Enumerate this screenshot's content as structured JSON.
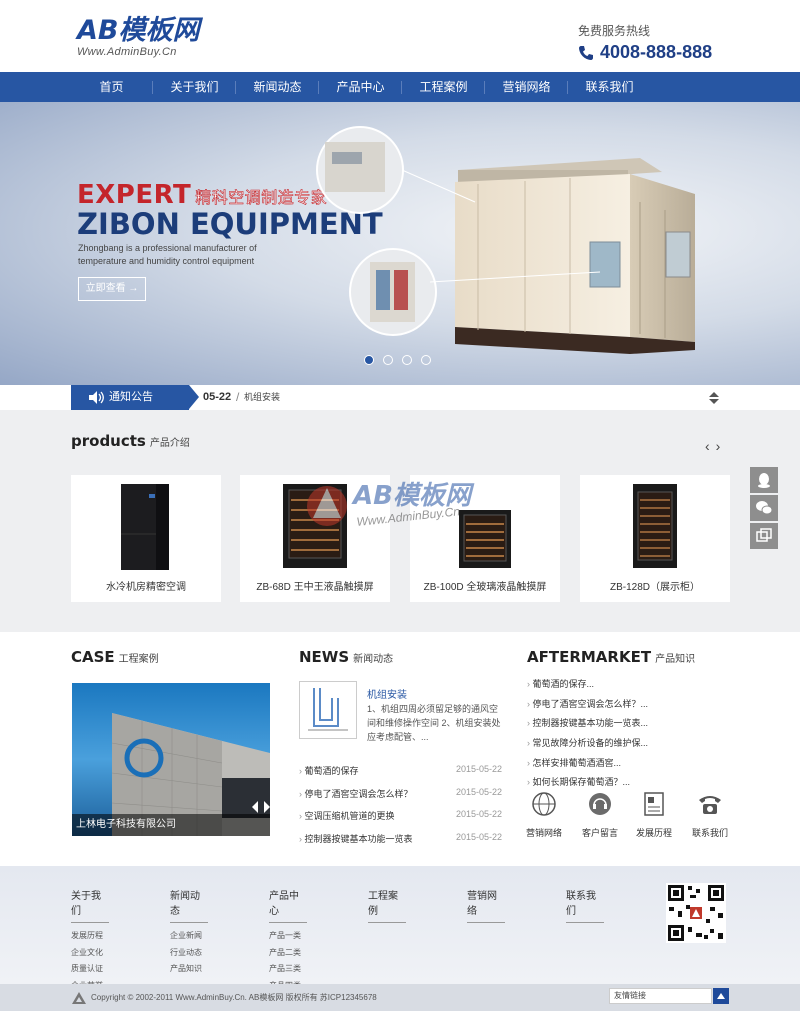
{
  "header": {
    "logo_main": "AB模板网",
    "logo_sub": "Www.AdminBuy.Cn",
    "hotline_label": "免费服务热线",
    "hotline_number": "4008-888-888"
  },
  "nav": {
    "items": [
      "首页",
      "关于我们",
      "新闻动态",
      "产品中心",
      "工程案例",
      "营销网络",
      "联系我们"
    ]
  },
  "banner": {
    "title_en": "EXPERT",
    "title_cn": "精科空调制造专家",
    "subtitle": "ZIBON EQUIPMENT",
    "description": "Zhongbang is a professional manufacturer of temperature and humidity control equipment",
    "button": "立即查看 →",
    "slides": 4,
    "active_slide": 1
  },
  "notice": {
    "label": "通知公告",
    "date": "05-22",
    "separator": "/",
    "text": "机组安装"
  },
  "products": {
    "title": "products",
    "subtitle": "产品介绍",
    "items": [
      {
        "name": "水冷机房精密空调"
      },
      {
        "name": "ZB-68D 王中王液晶触摸屏"
      },
      {
        "name": "ZB-100D 全玻璃液晶触摸屏"
      },
      {
        "name": "ZB-128D（展示柜）"
      }
    ]
  },
  "watermark": {
    "main": "AB模板网",
    "sub": "Www.AdminBuy.Cn"
  },
  "case": {
    "title": "CASE",
    "subtitle": "工程案例",
    "caption": "上林电子科技有限公司"
  },
  "news": {
    "title": "NEWS",
    "subtitle": "新闻动态",
    "feature_title": "机组安装",
    "feature_text": "1、机组四周必须留足够的通风空间和维修操作空间 2、机组安装处应考虑配管、...",
    "items": [
      {
        "title": "葡萄酒的保存",
        "date": "2015-05-22"
      },
      {
        "title": "停电了酒窖空调会怎么样？",
        "date": "2015-05-22"
      },
      {
        "title": "空调压缩机管道的更换",
        "date": "2015-05-22"
      },
      {
        "title": "控制器按键基本功能一览表",
        "date": "2015-05-22"
      }
    ]
  },
  "aftermarket": {
    "title": "AFTERMARKET",
    "subtitle": "产品知识",
    "items": [
      "葡萄酒的保存...",
      "停电了酒窖空调会怎么样？...",
      "控制器按键基本功能一览表...",
      "常见故障分析设备的维护保...",
      "怎样安排葡萄酒酒窖...",
      "如何长期保存葡萄酒？..."
    ],
    "quick_links": [
      "营销网络",
      "客户留言",
      "发展历程",
      "联系我们"
    ]
  },
  "footer": {
    "columns": [
      {
        "head": "关于我们",
        "links": [
          "发展历程",
          "企业文化",
          "质量认证",
          "企业荣誉"
        ]
      },
      {
        "head": "新闻动态",
        "links": [
          "企业新闻",
          "行业动态",
          "产品知识"
        ]
      },
      {
        "head": "产品中心",
        "links": [
          "产品一类",
          "产品二类",
          "产品三类",
          "产品四类"
        ]
      },
      {
        "head": "工程案例",
        "links": []
      },
      {
        "head": "营销网络",
        "links": []
      },
      {
        "head": "联系我们",
        "links": []
      }
    ],
    "copyright": "Copyright © 2002-2011 Www.AdminBuy.Cn. AB模板网 版权所有 苏ICP12345678",
    "links_select": "友情链接"
  },
  "colors": {
    "brand_blue": "#2756a3",
    "accent_red": "#c4252b"
  }
}
